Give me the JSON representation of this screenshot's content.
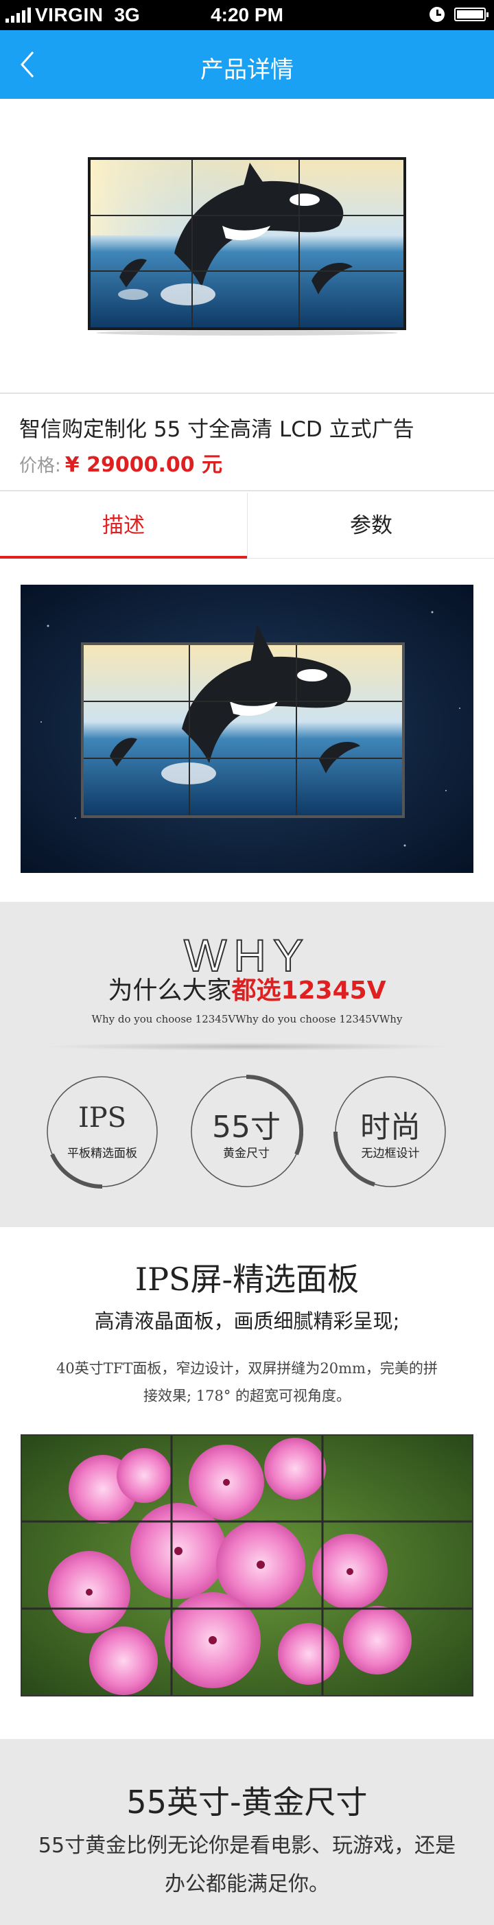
{
  "status_bar": {
    "carrier": "VIRGIN",
    "network": "3G",
    "time": "4:20 PM",
    "icons": [
      "signal-icon",
      "alarm-clock-icon",
      "battery-icon"
    ]
  },
  "nav": {
    "title": "产品详情",
    "back_icon": "chevron-left-icon"
  },
  "product": {
    "name": "智信购定制化 55 寸全高清 LCD 立式广告",
    "price_label": "价格:",
    "price": "¥ 29000.00 元"
  },
  "tabs": [
    {
      "label": "描述",
      "active": true
    },
    {
      "label": "参数",
      "active": false
    }
  ],
  "why": {
    "big_text": "WHY",
    "heading_prefix": "为什么大家",
    "heading_highlight": "都选12345V",
    "subtitle": "Why do you choose 12345VWhy do you choose 12345VWhy",
    "features": [
      {
        "title": "IPS",
        "subtitle": "平板精选面板"
      },
      {
        "title": "55寸",
        "subtitle": "黄金尺寸"
      },
      {
        "title": "时尚",
        "subtitle": "无边框设计"
      }
    ]
  },
  "ips": {
    "title": "IPS屏-精选面板",
    "subtitle": "高清液晶面板，画质细腻精彩呈现;",
    "desc_line1": "40英寸TFT面板，窄边设计，双屏拼缝为20mm，完美的拼",
    "desc_line2": "接效果; 178° 的超宽可视角度。"
  },
  "golden": {
    "title": "55英寸-黄金尺寸",
    "desc_line1": "55寸黄金比例无论你是看电影、玩游戏，还是",
    "desc_line2": "办公都能满足你。"
  },
  "colors": {
    "nav_blue": "#1aa1f4",
    "accent_red": "#e02020",
    "section_gray": "#e8e8e8"
  }
}
